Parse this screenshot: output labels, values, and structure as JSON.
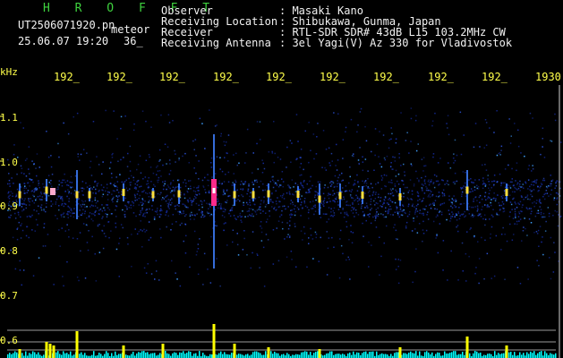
{
  "header": {
    "app_name": "H R O F F T",
    "filename": "UT2506071920.pn",
    "suffix": "meteor",
    "datetime": "25.06.07 19:20",
    "counter": "36_",
    "fields": [
      {
        "label": "Observer",
        "value": ": Masaki Kano"
      },
      {
        "label": "Receiving Location",
        "value": ": Shibukawa, Gunma, Japan"
      },
      {
        "label": "Receiver",
        "value": ": RTL-SDR SDR# 43dB L15 103.2MHz CW"
      },
      {
        "label": "Receiving Antenna",
        "value": ": 3el Yagi(V) Az 330 for Vladivostok"
      }
    ]
  },
  "axis": {
    "unit": "kHz",
    "y_ticks": [
      "1.1",
      "1.0",
      "0.9",
      "0.8",
      "0.7",
      "0.6"
    ],
    "x_ticks": [
      "192_",
      "192_",
      "192_",
      "192_",
      "192_",
      "192_",
      "192_",
      "192_",
      "192_",
      "1930"
    ]
  },
  "colors": {
    "background": "#000000",
    "text_green": "#3fd23f",
    "text_white": "#f2f2f2",
    "text_yellow": "#ffff4a",
    "noise_blue": "#1a2ea0",
    "echo_magenta": "#ff2a8a",
    "bar_yellow": "#ffff00",
    "bar_cyan": "#00ffff"
  }
}
